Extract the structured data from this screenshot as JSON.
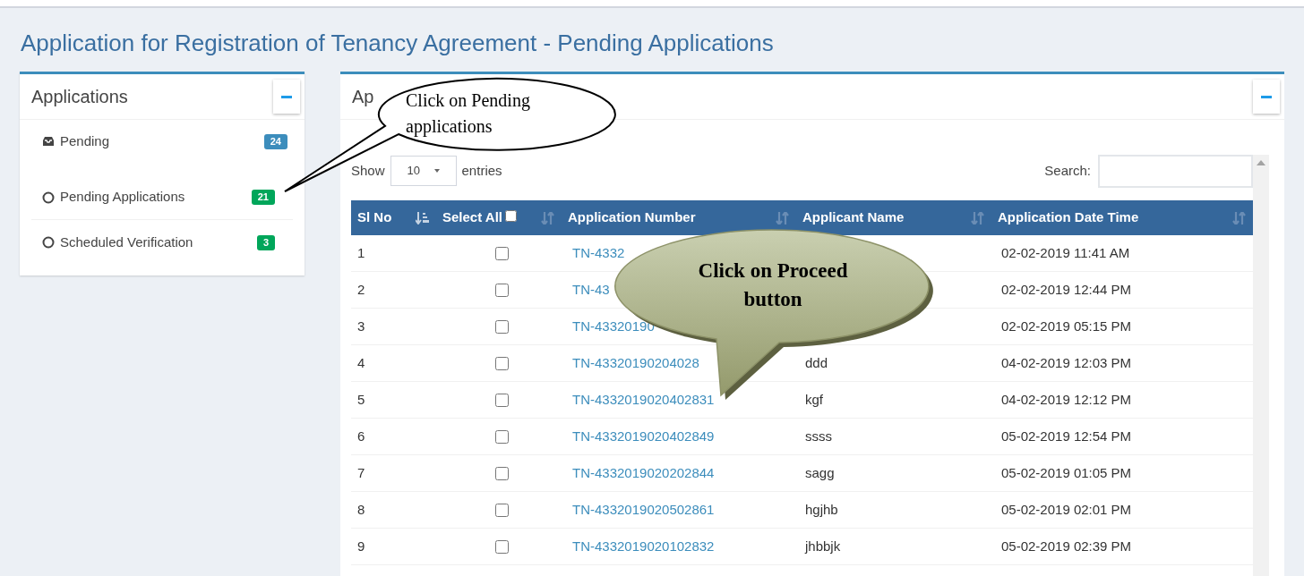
{
  "page_title": "Application for Registration of Tenancy Agreement - Pending Applications",
  "applications_panel": {
    "title": "Applications",
    "items": [
      {
        "label": "Pending",
        "badge": "24",
        "color": "#3c8dbc",
        "kind": "folder",
        "children": [
          {
            "label": "Pending Applications",
            "badge": "21",
            "color": "#00a65a",
            "kind": "circle"
          },
          {
            "label": "Scheduled Verification",
            "badge": "3",
            "color": "#00a65a",
            "kind": "circle"
          }
        ]
      }
    ]
  },
  "list_panel": {
    "title": "Ap",
    "show_label": "Show",
    "page_size": "10",
    "entries_label": "entries",
    "search_label": "Search:",
    "table": {
      "select_all_checked": false,
      "columns": [
        {
          "label": "Sl No",
          "sorted": true
        },
        {
          "label": "Select All",
          "sorted": false
        },
        {
          "label": "Application Number",
          "sorted": false
        },
        {
          "label": "Applicant Name",
          "sorted": false
        },
        {
          "label": "Application Date Time",
          "sorted": false
        }
      ],
      "rows": [
        {
          "sl": "1",
          "checked": false,
          "number": "TN-4332",
          "date": "02-02-2019 11:41 AM"
        },
        {
          "sl": "2",
          "checked": false,
          "number": "TN-43",
          "date": "02-02-2019 12:44 PM"
        },
        {
          "sl": "3",
          "checked": false,
          "number": "TN-43320190",
          "date": "02-02-2019 05:15 PM"
        },
        {
          "sl": "4",
          "checked": false,
          "number": "TN-43320190204028",
          "name": "ddd",
          "date": "04-02-2019 12:03 PM"
        },
        {
          "sl": "5",
          "checked": false,
          "number": "TN-4332019020402831",
          "name": "kgf",
          "date": "04-02-2019 12:12 PM"
        },
        {
          "sl": "6",
          "checked": false,
          "number": "TN-4332019020402849",
          "name": "ssss",
          "date": "05-02-2019 12:54 PM"
        },
        {
          "sl": "7",
          "checked": false,
          "number": "TN-4332019020202844",
          "name": "sagg",
          "date": "05-02-2019 01:05 PM"
        },
        {
          "sl": "8",
          "checked": false,
          "number": "TN-4332019020502861",
          "name": "hgjhb",
          "date": "05-02-2019 02:01 PM"
        },
        {
          "sl": "9",
          "checked": false,
          "number": "TN-4332019020102832",
          "name": "jhbbjk",
          "date": "05-02-2019 02:39 PM"
        }
      ]
    }
  },
  "callouts": [
    {
      "kind": "outline",
      "lines": [
        "Click on Pending",
        "applications"
      ]
    },
    {
      "kind": "olive",
      "lines": [
        "Click on Proceed",
        "button"
      ]
    }
  ]
}
